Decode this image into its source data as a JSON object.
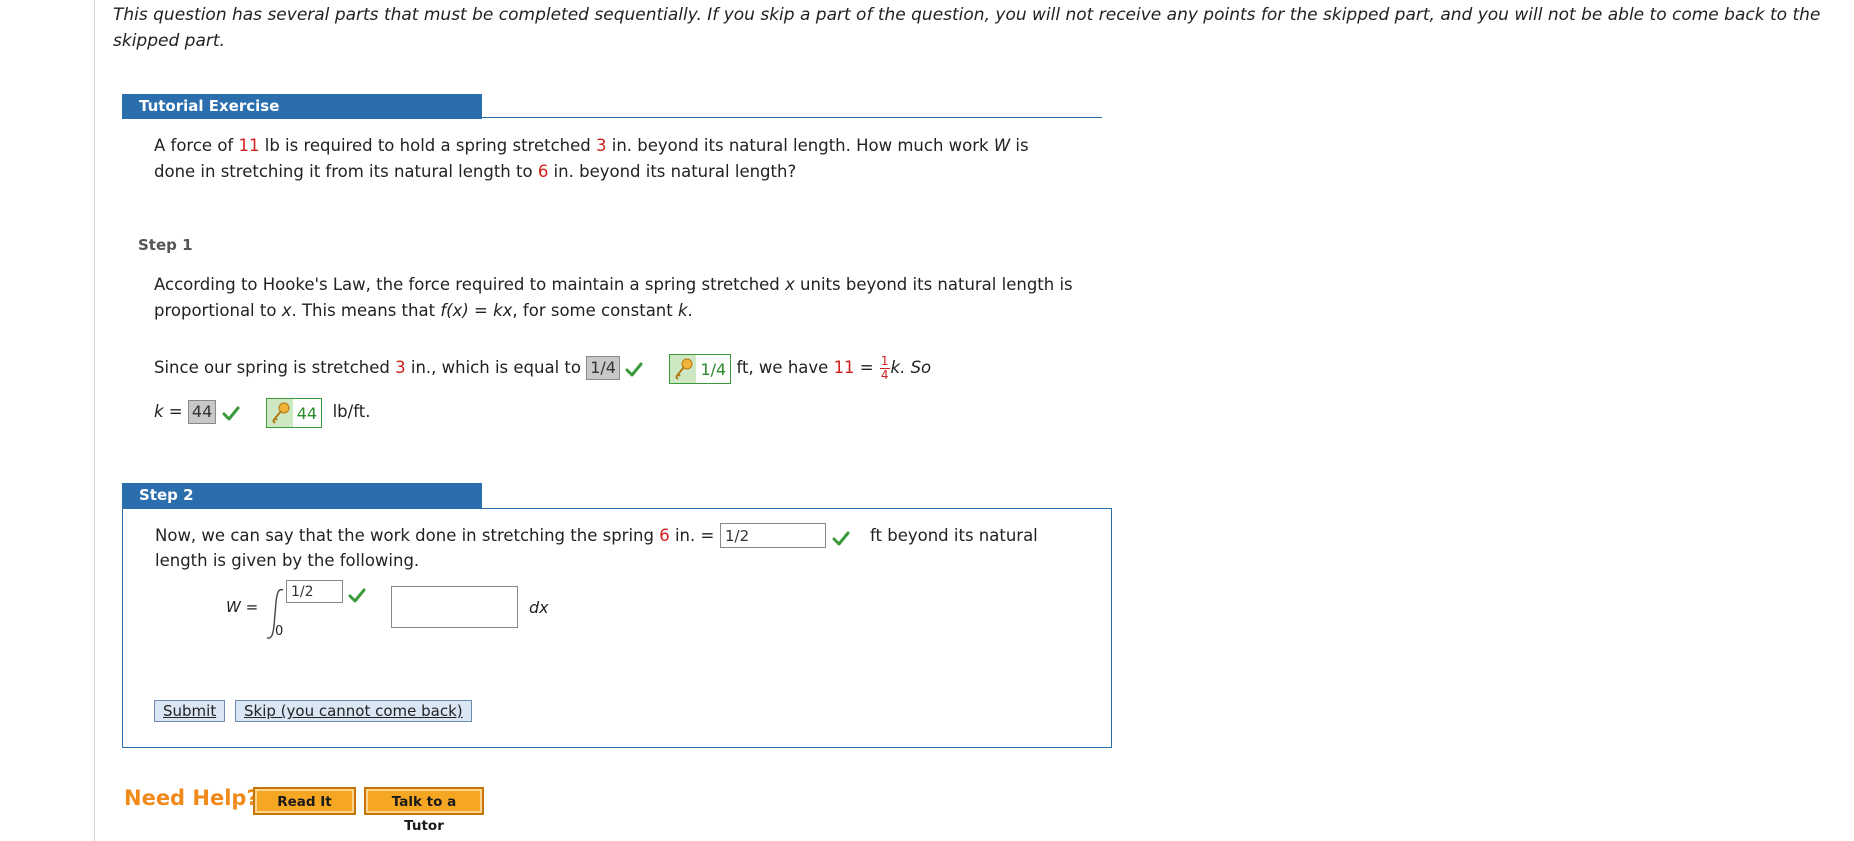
{
  "intro": {
    "text": "This question has several parts that must be completed sequentially. If you skip a part of the question, you will not receive any points for the skipped part, and you will not be able to come back to the skipped part."
  },
  "tutorial": {
    "header": "Tutorial Exercise",
    "problem": {
      "p1": "A force of ",
      "force": "11",
      "p2": " lb is required to hold a spring stretched ",
      "stretch": "3",
      "p3": " in. beyond its natural length. How much work ",
      "var_w": "W",
      "p4": " is done in stretching it from its natural length to ",
      "target": "6",
      "p5": " in. beyond its natural length?"
    }
  },
  "step1": {
    "label": "Step 1",
    "law": {
      "p1": "According to Hooke's Law, the force required to maintain a spring stretched ",
      "x1": "x",
      "p2": " units beyond its natural length is proportional to ",
      "x2": "x",
      "p3": ". This means that ",
      "fx": "f(x)",
      "eq": " = ",
      "kx": "kx",
      "p4": ", for some constant ",
      "k": "k",
      "p5": "."
    },
    "line2": {
      "p1": "Since our spring is stretched ",
      "stretch": "3",
      "p2": " in., which is equal to ",
      "answer": "1/4",
      "key_answer": "1/4",
      "p3": " ft, we have ",
      "force": "11",
      "p4": " = ",
      "frac_num": "1",
      "frac_den": "4",
      "p5": "k. So"
    },
    "line3": {
      "k": "k",
      "eq": " = ",
      "answer": "44",
      "key_answer": "44",
      "unit": "lb/ft."
    }
  },
  "step2": {
    "header": "Step 2",
    "p1": "Now, we can say that the work done in stretching the spring ",
    "target": "6",
    "p2": " in. = ",
    "ft_value": "1/2",
    "p3": "ft beyond its natural",
    "p4": "length is given by the following.",
    "w_label": "W =",
    "upper_limit": "1/2",
    "lower_limit": "0",
    "integrand": "",
    "dx": "dx",
    "submit": "Submit",
    "skip": "Skip (you cannot come back)"
  },
  "help": {
    "label": "Need Help?",
    "read_it": "Read It",
    "talk_to_tutor": "Talk to a Tutor"
  },
  "colors": {
    "accent_blue": "#2a6ead",
    "highlight_red": "#d0211c",
    "correct_green": "#3a9a3a",
    "help_orange": "#f08a1b"
  }
}
